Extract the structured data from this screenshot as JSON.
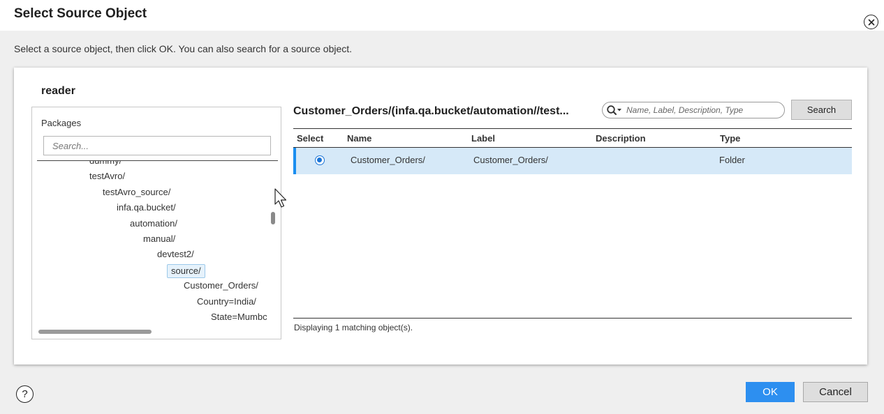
{
  "dialog": {
    "title": "Select Source Object",
    "instructions": "Select a source object, then click OK. You can also search for a source object."
  },
  "connection_name": "reader",
  "packages": {
    "label": "Packages",
    "search_placeholder": "Search...",
    "tree": [
      {
        "label": "dummy/",
        "depth": 0
      },
      {
        "label": "testAvro/",
        "depth": 0
      },
      {
        "label": "testAvro_source/",
        "depth": 1
      },
      {
        "label": "infa.qa.bucket/",
        "depth": 2
      },
      {
        "label": "automation/",
        "depth": 3
      },
      {
        "label": "manual/",
        "depth": 4
      },
      {
        "label": "devtest2/",
        "depth": 5
      },
      {
        "label": "source/",
        "depth": 6,
        "selected": true
      },
      {
        "label": "Customer_Orders/",
        "depth": 7
      },
      {
        "label": "Country=India/",
        "depth": 8
      },
      {
        "label": "State=Mumbc",
        "depth": 9
      }
    ]
  },
  "objects": {
    "path_title": "Customer_Orders/(infa.qa.bucket/automation//test...",
    "search_placeholder": "Name, Label, Description, Type",
    "search_button": "Search",
    "columns": {
      "select": "Select",
      "name": "Name",
      "label": "Label",
      "description": "Description",
      "type": "Type"
    },
    "rows": [
      {
        "selected": true,
        "name": "Customer_Orders/",
        "label": "Customer_Orders/",
        "description": "",
        "type": "Folder"
      }
    ],
    "status": "Displaying 1 matching object(s)."
  },
  "footer": {
    "help_symbol": "?",
    "ok_label": "OK",
    "cancel_label": "Cancel"
  },
  "colors": {
    "accent": "#2d8ff0",
    "row_selected_bg": "#d6e9f8",
    "tree_selected_bg": "#e6f2fb"
  },
  "icons": {
    "close": "close-circle-icon",
    "search": "magnifier-dropdown-icon",
    "help": "help-circle-icon"
  }
}
